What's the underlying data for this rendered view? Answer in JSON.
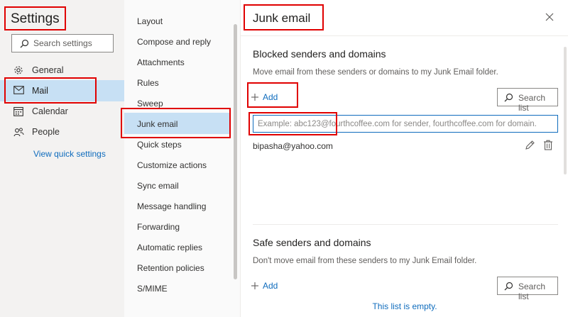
{
  "settings": {
    "title": "Settings",
    "search_placeholder": "Search settings",
    "nav": [
      {
        "label": "General",
        "icon": "gear-icon"
      },
      {
        "label": "Mail",
        "icon": "mail-icon",
        "active": true
      },
      {
        "label": "Calendar",
        "icon": "calendar-icon"
      },
      {
        "label": "People",
        "icon": "people-icon"
      }
    ],
    "quick_settings": "View quick settings"
  },
  "mail_menu": {
    "items": [
      {
        "label": "Layout"
      },
      {
        "label": "Compose and reply"
      },
      {
        "label": "Attachments"
      },
      {
        "label": "Rules"
      },
      {
        "label": "Sweep"
      },
      {
        "label": "Junk email",
        "active": true
      },
      {
        "label": "Quick steps"
      },
      {
        "label": "Customize actions"
      },
      {
        "label": "Sync email"
      },
      {
        "label": "Message handling"
      },
      {
        "label": "Forwarding"
      },
      {
        "label": "Automatic replies"
      },
      {
        "label": "Retention policies"
      },
      {
        "label": "S/MIME"
      }
    ]
  },
  "junk": {
    "title": "Junk email",
    "blocked": {
      "title": "Blocked senders and domains",
      "description": "Move email from these senders or domains to my Junk Email folder.",
      "add_label": "Add",
      "search_label": "Search list",
      "input_placeholder": "Example: abc123@fourthcoffee.com for sender, fourthcoffee.com for domain.",
      "entries": [
        "bipasha@yahoo.com"
      ]
    },
    "safe": {
      "title": "Safe senders and domains",
      "description": "Don't move email from these senders to my Junk Email folder.",
      "add_label": "Add",
      "search_label": "Search list",
      "empty_text": "This list is empty."
    }
  },
  "colors": {
    "accent": "#0f6cbd",
    "selected": "#c7e0f4",
    "highlight": "#e00000"
  }
}
